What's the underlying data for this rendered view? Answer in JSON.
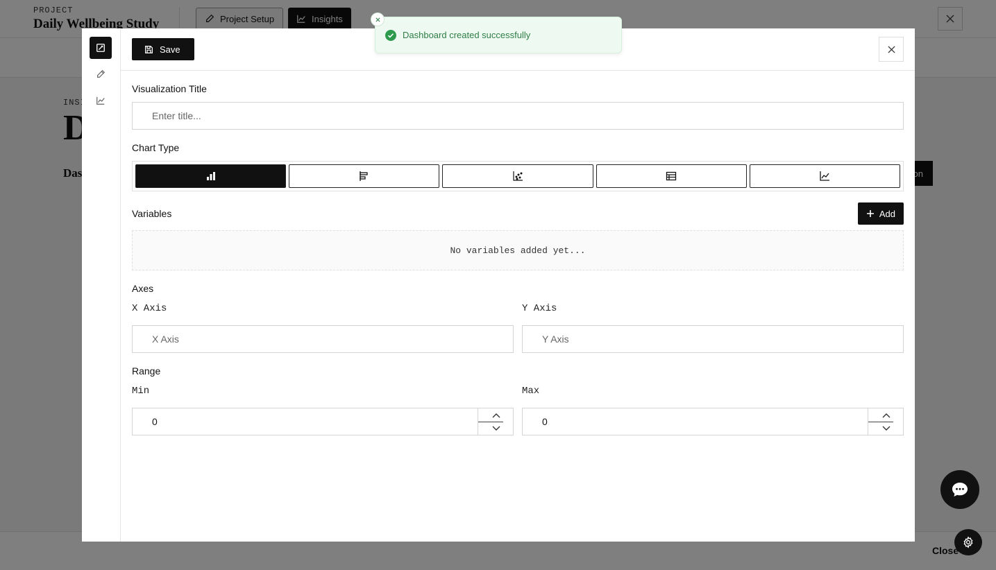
{
  "background": {
    "project_label": "PROJECT",
    "project_name": "Daily Wellbeing Study",
    "tabs": [
      {
        "label": "Project Setup"
      },
      {
        "label": "Insights"
      }
    ],
    "insights_label": "INSI",
    "big_letter": "D",
    "dash_label": "Das",
    "action_label": "on",
    "footer_close": "Close"
  },
  "toast": {
    "message": "Dashboard created successfully"
  },
  "modal": {
    "save_label": "Save",
    "title_section": {
      "label": "Visualization Title",
      "placeholder": "Enter title..."
    },
    "chart_type": {
      "label": "Chart Type",
      "options": [
        "bar-chart-icon",
        "horizontal-bar-icon",
        "scatter-icon",
        "table-icon",
        "line-chart-icon"
      ],
      "selected_index": 0
    },
    "variables": {
      "label": "Variables",
      "add_label": "Add",
      "empty_text": "No variables added yet..."
    },
    "axes": {
      "label": "Axes",
      "x_label": "X Axis",
      "x_placeholder": "X Axis",
      "y_label": "Y Axis",
      "y_placeholder": "Y Axis"
    },
    "range": {
      "label": "Range",
      "min_label": "Min",
      "min_value": "0",
      "max_label": "Max",
      "max_value": "0"
    }
  },
  "colors": {
    "primary": "#111111",
    "toast_bg": "#eefaf1",
    "toast_text": "#2f7d46",
    "success_icon": "#2e9a4e"
  }
}
